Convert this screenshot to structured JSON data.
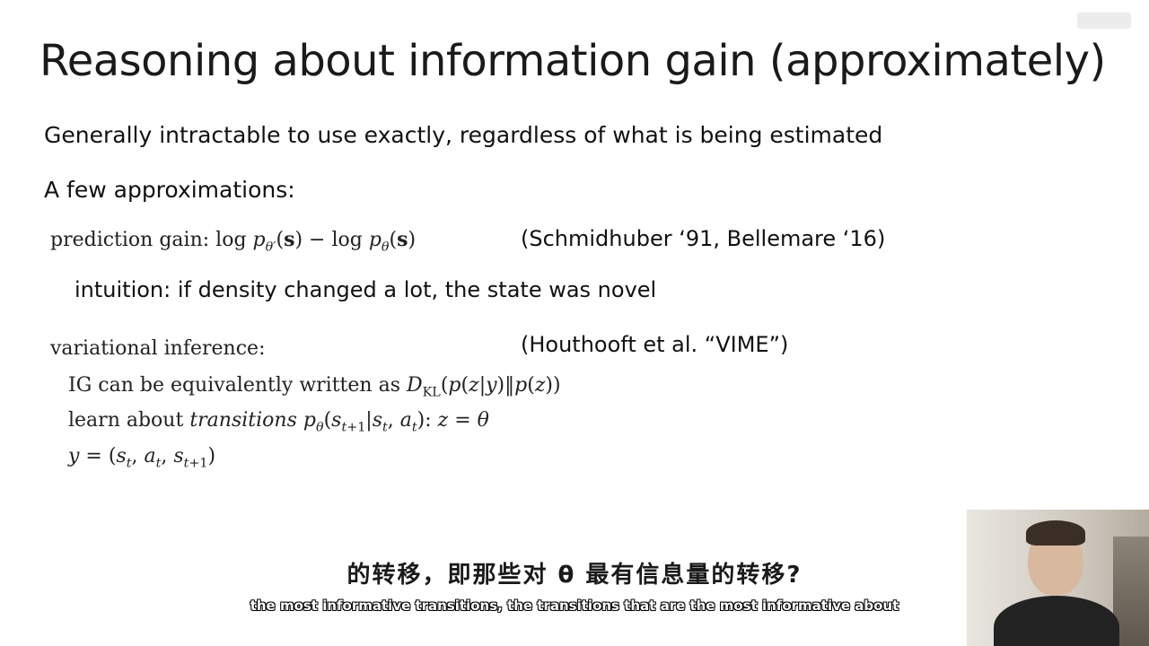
{
  "slide": {
    "title": "Reasoning about information gain (approximately)",
    "line1": "Generally intractable to use exactly, regardless of what is being estimated",
    "line2": "A few approximations:",
    "prediction_gain_label": "prediction gain: ",
    "prediction_gain_ref": "(Schmidhuber ‘91, Bellemare ‘16)",
    "intuition": "intuition: if density changed a lot, the state was novel",
    "variational_label": "variational inference:",
    "variational_ref": "(Houthooft et al. “VIME”)",
    "ig_text": "IG can be equivalently written as ",
    "learn_text": "learn about ",
    "transitions_word": "transitions"
  },
  "subtitles": {
    "zh": "的转移，即那些对 θ 最有信息量的转移?",
    "en": "the most informative transitions, the transitions that are the most informative about"
  }
}
